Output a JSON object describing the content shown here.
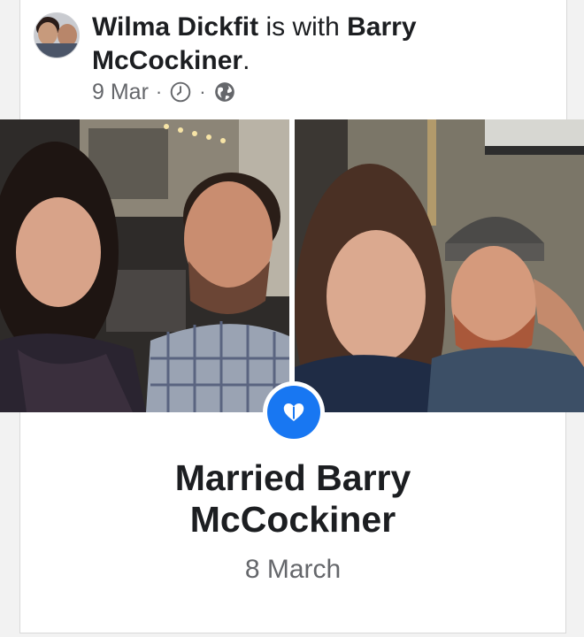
{
  "post": {
    "author": "Wilma Dickfit",
    "with_text": " is with ",
    "tagged_line1": "Barry",
    "tagged_line2": "McCockiner",
    "period": ".",
    "date": "9 Mar",
    "separator": "·",
    "icons": [
      "clock-icon",
      "globe-icon"
    ]
  },
  "photos": [
    {
      "name": "couple-photo-bar"
    },
    {
      "name": "couple-photo-garage"
    }
  ],
  "life_event": {
    "icon": "heart-icon",
    "title_line1": "Married Barry",
    "title_line2": "McCockiner",
    "date": "8 March",
    "accent_color": "#1877f2"
  }
}
